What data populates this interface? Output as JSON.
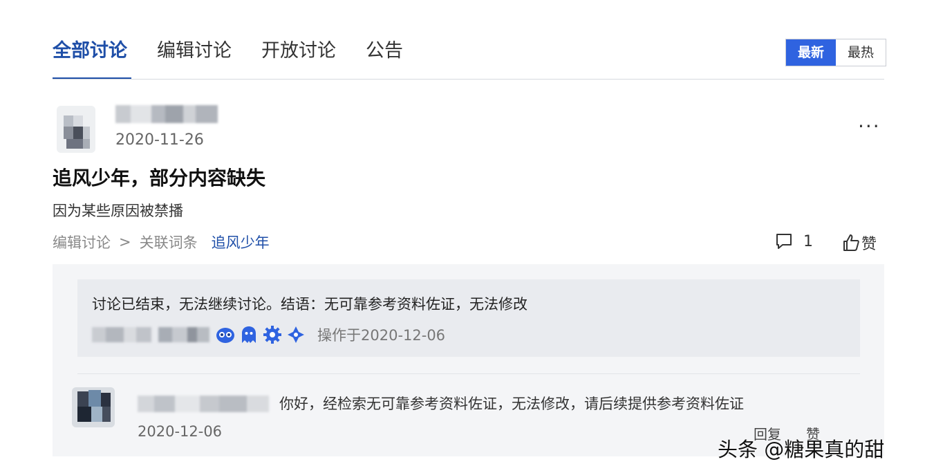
{
  "tabs": [
    {
      "label": "全部讨论",
      "active": true
    },
    {
      "label": "编辑讨论",
      "active": false
    },
    {
      "label": "开放讨论",
      "active": false
    },
    {
      "label": "公告",
      "active": false
    }
  ],
  "sort": {
    "newest": "最新",
    "hottest": "最热"
  },
  "post": {
    "date": "2020-11-26",
    "more": "···",
    "title": "追风少年，部分内容缺失",
    "body": "因为某些原因被禁播",
    "breadcrumb": {
      "category": "编辑讨论",
      "separator": ">",
      "related": "关联词条",
      "entry": "追风少年"
    },
    "comment_count": "1",
    "like_label": "赞"
  },
  "closed_notice": {
    "text": "讨论已结束，无法继续讨论。结语：无可靠参考资料佐证，无法修改",
    "operated_at": "操作于2020-12-06"
  },
  "reply": {
    "text": "你好，经检索无可靠参考资料佐证，无法修改，请后续提供参考资料佐证",
    "date": "2020-12-06",
    "reply_label": "回复",
    "like_label": "赞"
  },
  "watermark": "头条 @糖果真的甜",
  "colors": {
    "accent": "#1f4fa8",
    "button_active": "#2f63e0",
    "panel": "#f4f5f7"
  },
  "icons": {
    "comment": "speech-bubble-icon",
    "like": "thumbs-up-icon",
    "more": "more-dots-icon"
  }
}
